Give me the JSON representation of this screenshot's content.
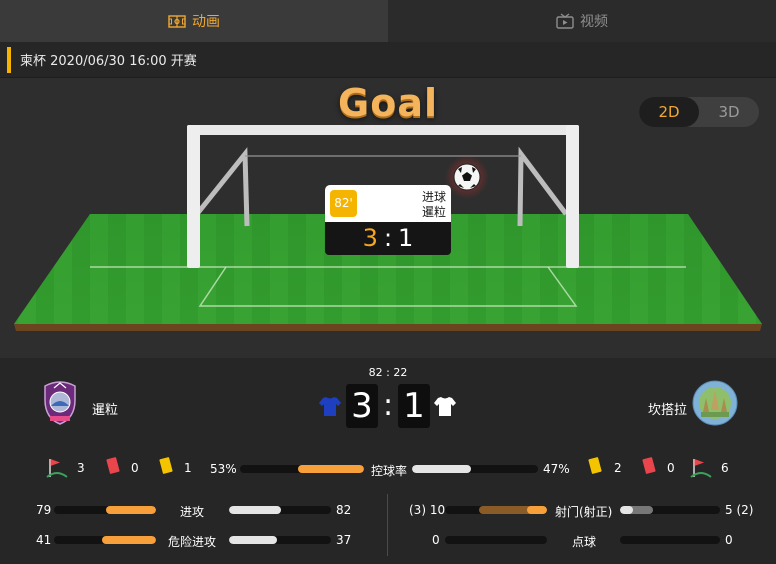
{
  "tabs": [
    {
      "label": "动画",
      "icon": "field-icon",
      "active": true
    },
    {
      "label": "视频",
      "icon": "video-icon",
      "active": false
    }
  ],
  "match_info": "柬杯 2020/06/30 16:00 开赛",
  "animation": {
    "title": "Goal",
    "view_toggle": {
      "option_2d": "2D",
      "option_3d": "3D",
      "selected": "2D"
    },
    "event": {
      "minute": "82'",
      "type": "进球",
      "team": "暹粒",
      "home_score": "3",
      "away_score": "1",
      "separator": ":"
    }
  },
  "score": {
    "clock": "82 : 22",
    "home": {
      "name": "暹粒",
      "score": "3",
      "jersey_color": "#1e40c0"
    },
    "away": {
      "name": "坎搭拉",
      "score": "1",
      "jersey_color": "#ffffff"
    },
    "separator": ":"
  },
  "stats": {
    "home_corners": "3",
    "home_red": "0",
    "home_yellow": "1",
    "away_yellow": "2",
    "away_red": "0",
    "away_corners": "6",
    "possession": {
      "label": "控球率",
      "home": "53%",
      "away": "47%",
      "home_value": 53,
      "away_value": 47
    },
    "attack": {
      "label": "进攻",
      "home": "79",
      "away": "82",
      "home_value": 79,
      "away_value": 82
    },
    "dangerous_attack": {
      "label": "危险进攻",
      "home": "41",
      "away": "37",
      "home_value": 41,
      "away_value": 37
    },
    "shots": {
      "label": "射门(射正)",
      "home": "(3) 10",
      "away": "5 (2)",
      "home_value": 10,
      "home_on_target": 3,
      "away_value": 5,
      "away_on_target": 2
    },
    "penalties": {
      "label": "点球",
      "home": "0",
      "away": "0",
      "home_value": 0,
      "away_value": 0
    }
  },
  "colors": {
    "accent": "#f0a830",
    "home_bar": "#f79f3a",
    "away_bar": "#e5e5e5",
    "yellow_card": "#f5c400",
    "red_card": "#e8454c"
  }
}
